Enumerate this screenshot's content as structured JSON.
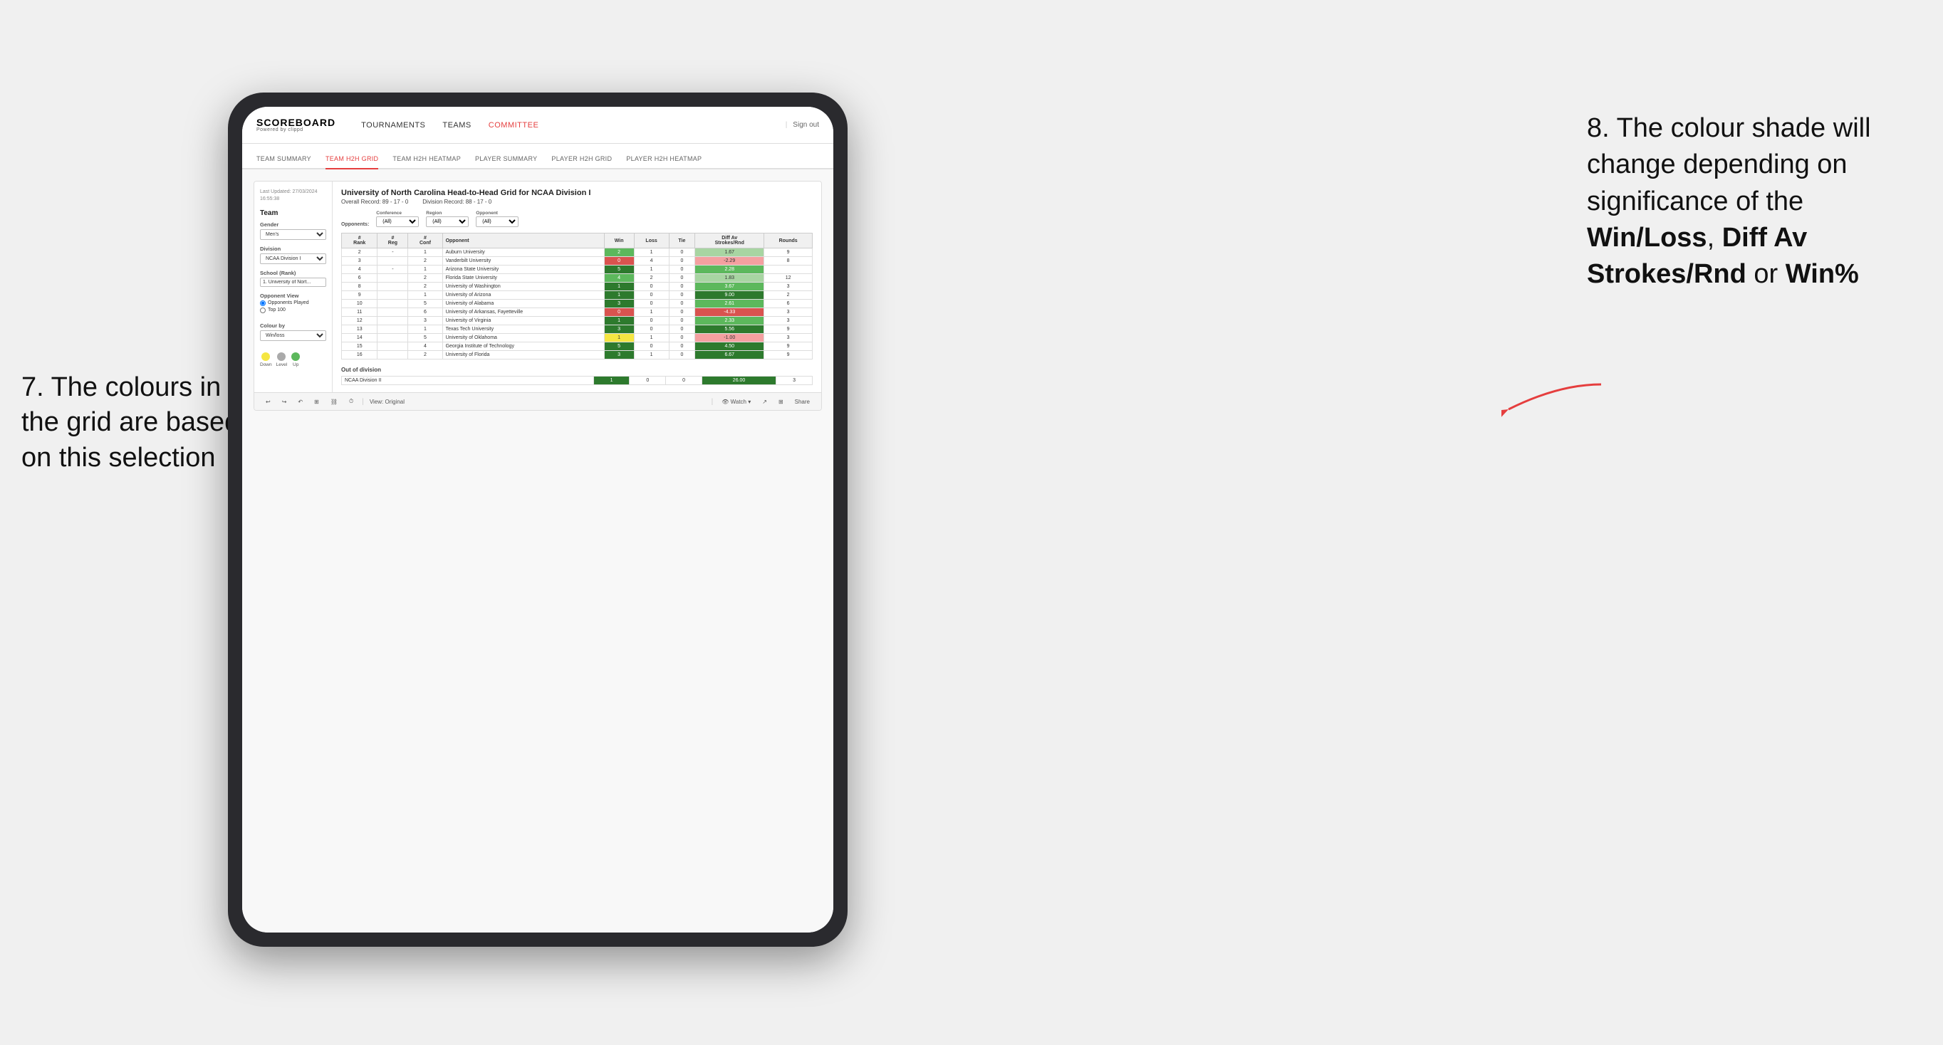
{
  "annotations": {
    "left_title": "7. The colours in the grid are based on this selection",
    "right_title_part1": "8. The colour shade will change depending on significance of the ",
    "right_bold1": "Win/Loss",
    "right_comma": ", ",
    "right_bold2": "Diff Av Strokes/Rnd",
    "right_or": " or ",
    "right_bold3": "Win%"
  },
  "nav": {
    "logo": "SCOREBOARD",
    "logo_sub": "Powered by clippd",
    "links": [
      "TOURNAMENTS",
      "TEAMS",
      "COMMITTEE"
    ],
    "active_link": "COMMITTEE",
    "sign_out": "Sign out"
  },
  "sub_nav": {
    "items": [
      "TEAM SUMMARY",
      "TEAM H2H GRID",
      "TEAM H2H HEATMAP",
      "PLAYER SUMMARY",
      "PLAYER H2H GRID",
      "PLAYER H2H HEATMAP"
    ],
    "active_item": "TEAM H2H GRID"
  },
  "tableau": {
    "last_updated": "Last Updated: 27/03/2024\n16:55:38",
    "title": "University of North Carolina Head-to-Head Grid for NCAA Division I",
    "overall_record": "Overall Record: 89 - 17 - 0",
    "division_record": "Division Record: 88 - 17 - 0",
    "filters": {
      "conference_label": "Conference",
      "conference_value": "(All)",
      "region_label": "Region",
      "region_value": "(All)",
      "opponent_label": "Opponent",
      "opponent_value": "(All)"
    },
    "left_panel": {
      "team_label": "Team",
      "gender_label": "Gender",
      "gender_value": "Men's",
      "division_label": "Division",
      "division_value": "NCAA Division I",
      "school_label": "School (Rank)",
      "school_value": "1. University of Nort...",
      "opponent_view_label": "Opponent View",
      "radio_options": [
        "Opponents Played",
        "Top 100"
      ],
      "radio_selected": "Opponents Played",
      "colour_by_label": "Colour by",
      "colour_by_value": "Win/loss",
      "legend": [
        {
          "label": "Down",
          "color": "#f5e642"
        },
        {
          "label": "Level",
          "color": "#aaaaaa"
        },
        {
          "label": "Up",
          "color": "#5cb85c"
        }
      ]
    },
    "table_headers": [
      "#\nRank",
      "#\nReg",
      "#\nConf",
      "Opponent",
      "Win",
      "Loss",
      "Tie",
      "Diff Av\nStrokes/Rnd",
      "Rounds"
    ],
    "rows": [
      {
        "rank": "2",
        "reg": "-",
        "conf": "1",
        "opponent": "Auburn University",
        "win": "2",
        "loss": "1",
        "tie": "0",
        "diff": "1.67",
        "rounds": "9",
        "win_color": "cell-green",
        "diff_color": "cell-light-green"
      },
      {
        "rank": "3",
        "reg": "",
        "conf": "2",
        "opponent": "Vanderbilt University",
        "win": "0",
        "loss": "4",
        "tie": "0",
        "diff": "-2.29",
        "rounds": "8",
        "win_color": "cell-red",
        "diff_color": "cell-pink"
      },
      {
        "rank": "4",
        "reg": "-",
        "conf": "1",
        "opponent": "Arizona State University",
        "win": "5",
        "loss": "1",
        "tie": "0",
        "diff": "2.28",
        "rounds": "",
        "win_color": "cell-green-dark",
        "diff_color": "cell-green"
      },
      {
        "rank": "6",
        "reg": "",
        "conf": "2",
        "opponent": "Florida State University",
        "win": "4",
        "loss": "2",
        "tie": "0",
        "diff": "1.83",
        "rounds": "12",
        "win_color": "cell-green",
        "diff_color": "cell-light-green"
      },
      {
        "rank": "8",
        "reg": "",
        "conf": "2",
        "opponent": "University of Washington",
        "win": "1",
        "loss": "0",
        "tie": "0",
        "diff": "3.67",
        "rounds": "3",
        "win_color": "cell-green-dark",
        "diff_color": "cell-green"
      },
      {
        "rank": "9",
        "reg": "",
        "conf": "1",
        "opponent": "University of Arizona",
        "win": "1",
        "loss": "0",
        "tie": "0",
        "diff": "9.00",
        "rounds": "2",
        "win_color": "cell-green-dark",
        "diff_color": "cell-green-dark"
      },
      {
        "rank": "10",
        "reg": "",
        "conf": "5",
        "opponent": "University of Alabama",
        "win": "3",
        "loss": "0",
        "tie": "0",
        "diff": "2.61",
        "rounds": "6",
        "win_color": "cell-green-dark",
        "diff_color": "cell-green"
      },
      {
        "rank": "11",
        "reg": "",
        "conf": "6",
        "opponent": "University of Arkansas, Fayetteville",
        "win": "0",
        "loss": "1",
        "tie": "0",
        "diff": "-4.33",
        "rounds": "3",
        "win_color": "cell-red",
        "diff_color": "cell-red"
      },
      {
        "rank": "12",
        "reg": "",
        "conf": "3",
        "opponent": "University of Virginia",
        "win": "1",
        "loss": "0",
        "tie": "0",
        "diff": "2.33",
        "rounds": "3",
        "win_color": "cell-green-dark",
        "diff_color": "cell-green"
      },
      {
        "rank": "13",
        "reg": "",
        "conf": "1",
        "opponent": "Texas Tech University",
        "win": "3",
        "loss": "0",
        "tie": "0",
        "diff": "5.56",
        "rounds": "9",
        "win_color": "cell-green-dark",
        "diff_color": "cell-green-dark"
      },
      {
        "rank": "14",
        "reg": "",
        "conf": "5",
        "opponent": "University of Oklahoma",
        "win": "1",
        "loss": "1",
        "tie": "0",
        "diff": "-1.00",
        "rounds": "3",
        "win_color": "cell-yellow",
        "diff_color": "cell-pink"
      },
      {
        "rank": "15",
        "reg": "",
        "conf": "4",
        "opponent": "Georgia Institute of Technology",
        "win": "5",
        "loss": "0",
        "tie": "0",
        "diff": "4.50",
        "rounds": "9",
        "win_color": "cell-green-dark",
        "diff_color": "cell-green-dark"
      },
      {
        "rank": "16",
        "reg": "",
        "conf": "2",
        "opponent": "University of Florida",
        "win": "3",
        "loss": "1",
        "tie": "0",
        "diff": "6.67",
        "rounds": "9",
        "win_color": "cell-green-dark",
        "diff_color": "cell-green-dark"
      }
    ],
    "out_of_division_label": "Out of division",
    "out_of_division_rows": [
      {
        "label": "NCAA Division II",
        "win": "1",
        "loss": "0",
        "tie": "0",
        "diff": "26.00",
        "rounds": "3",
        "win_color": "cell-green-dark",
        "diff_color": "cell-green-dark"
      }
    ],
    "bottom_toolbar": {
      "view_label": "View: Original",
      "watch_label": "Watch",
      "share_label": "Share"
    }
  }
}
